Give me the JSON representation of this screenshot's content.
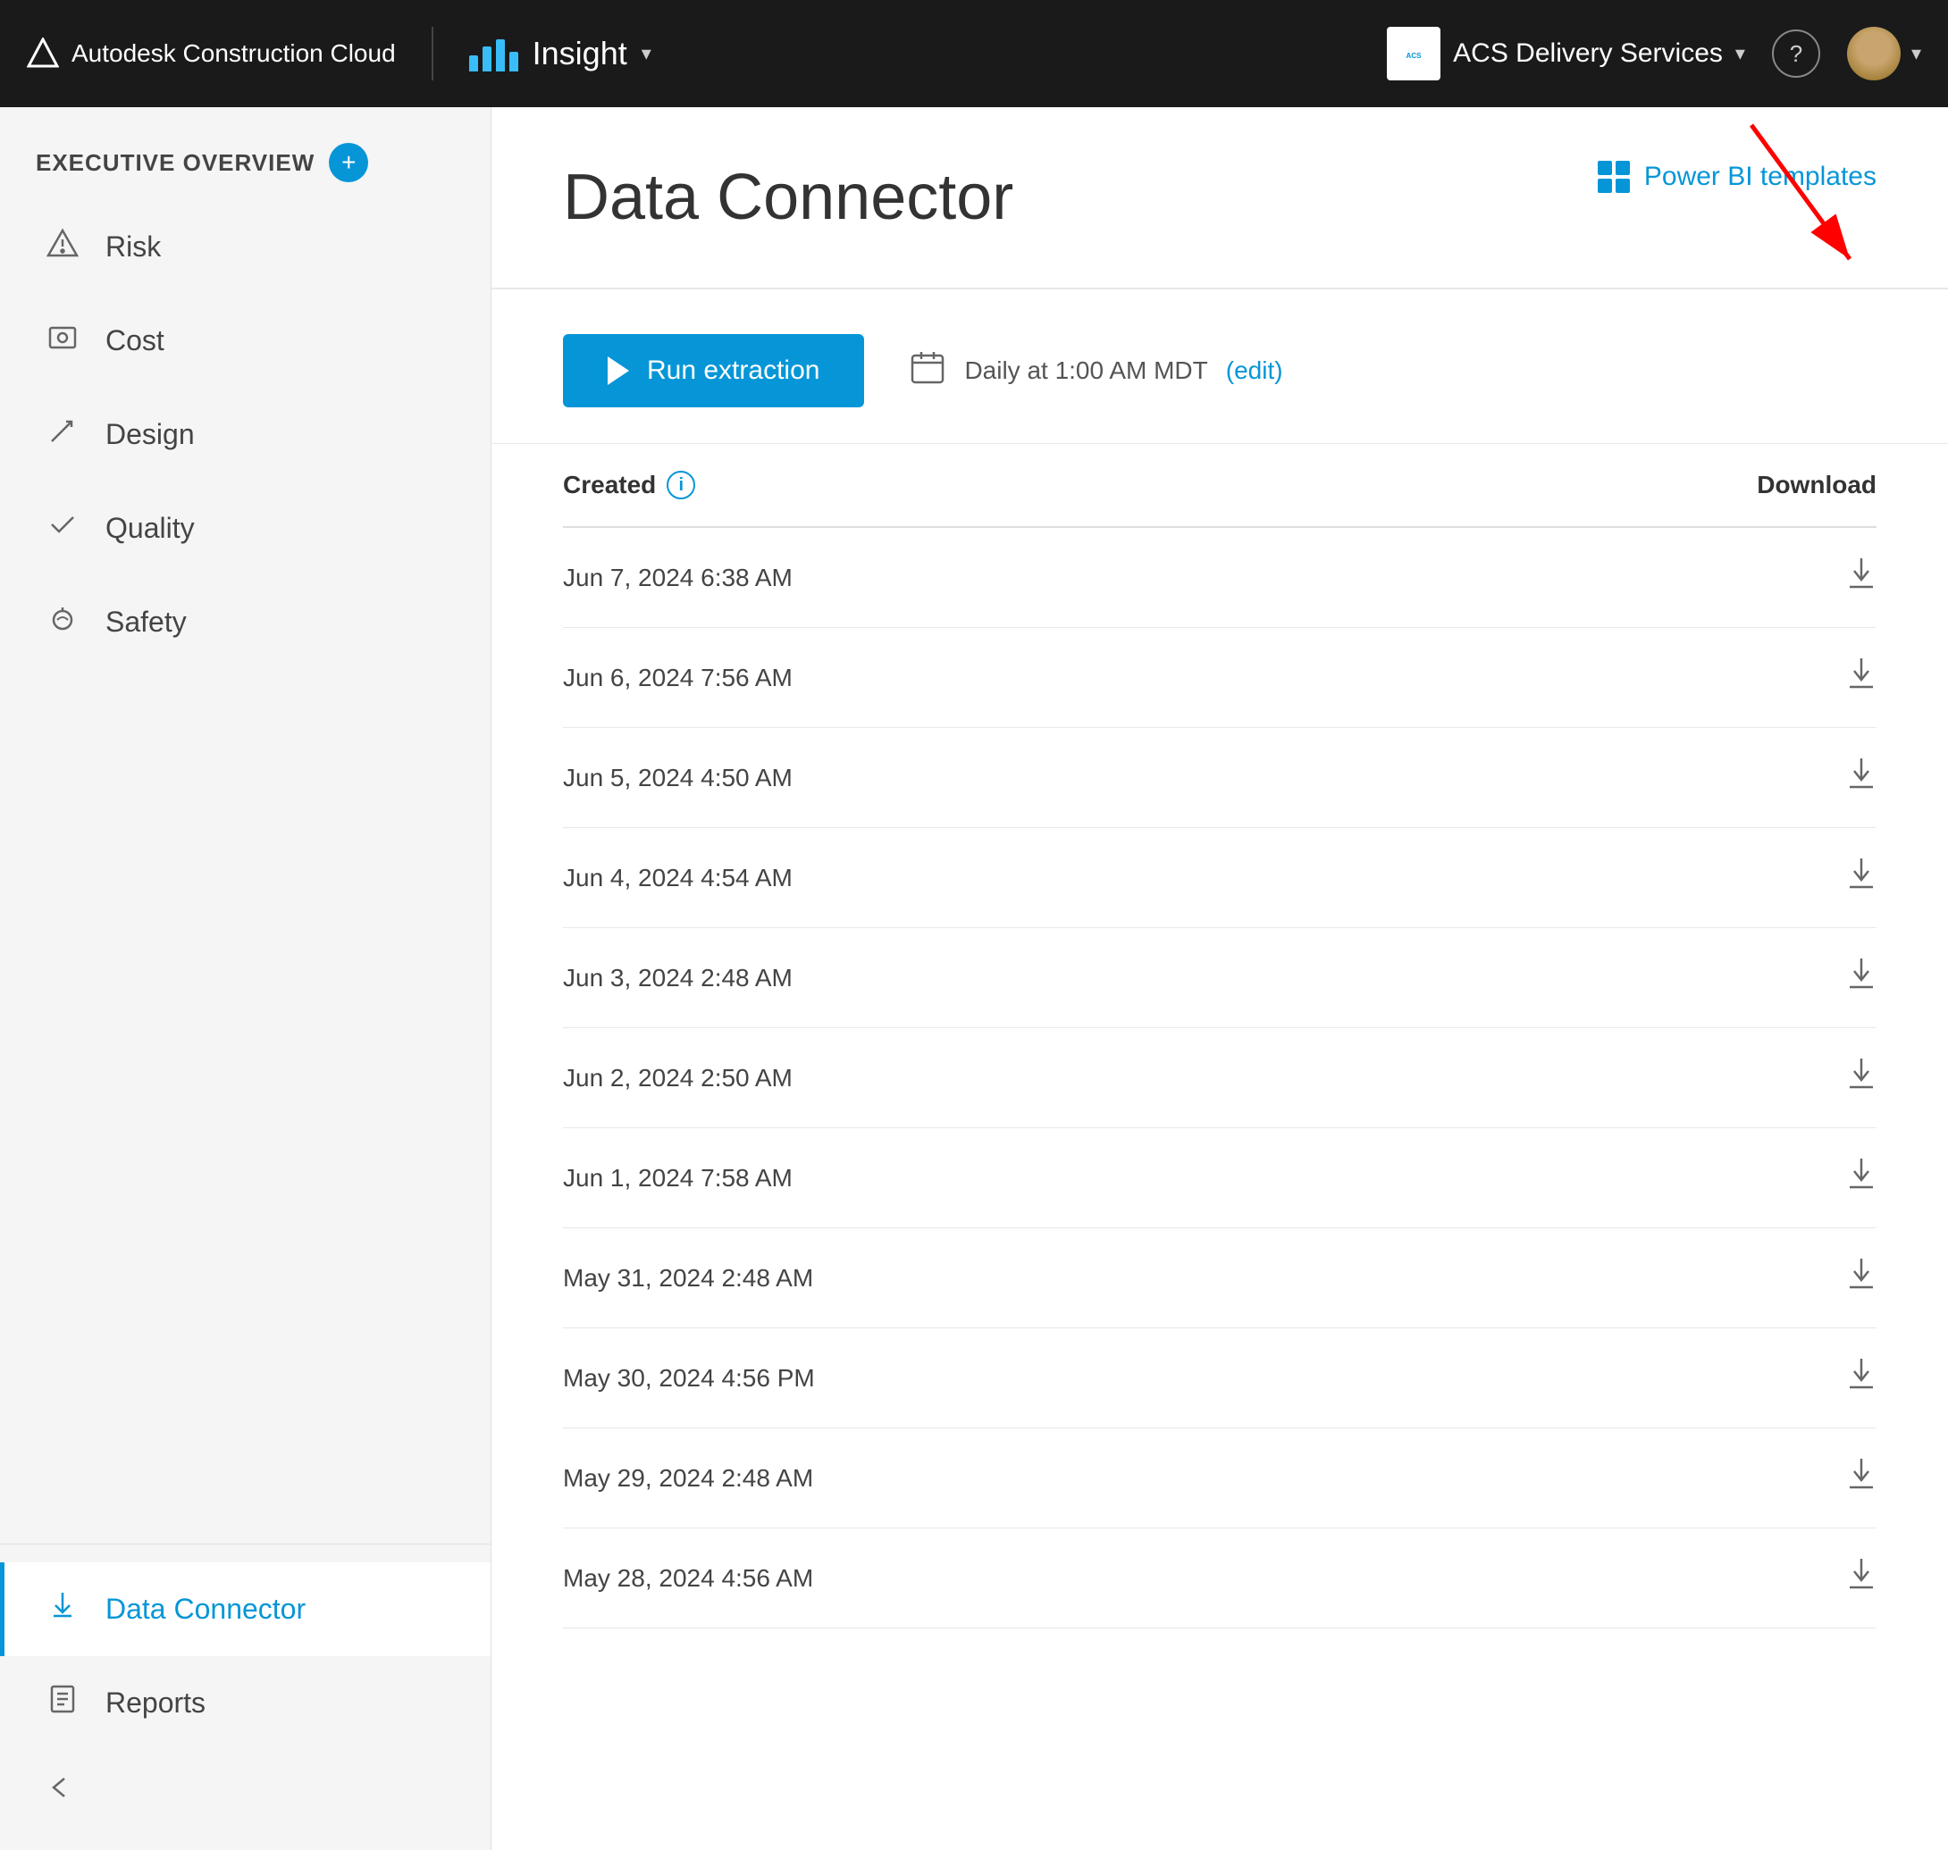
{
  "app": {
    "brand": "Autodesk Construction Cloud",
    "product": "Insight",
    "dropdown_arrow": "▾"
  },
  "org": {
    "name": "ACS Delivery Services",
    "dropdown_arrow": "▾"
  },
  "sidebar": {
    "section_label": "EXECUTIVE OVERVIEW",
    "add_label": "+",
    "nav_items": [
      {
        "id": "risk",
        "label": "Risk",
        "icon": "△"
      },
      {
        "id": "cost",
        "label": "Cost",
        "icon": "▣"
      },
      {
        "id": "design",
        "label": "Design",
        "icon": "✏"
      },
      {
        "id": "quality",
        "label": "Quality",
        "icon": "✓"
      },
      {
        "id": "safety",
        "label": "Safety",
        "icon": "⛑"
      }
    ],
    "bottom_items": [
      {
        "id": "data-connector",
        "label": "Data Connector",
        "icon": "↓",
        "active": true
      },
      {
        "id": "reports",
        "label": "Reports",
        "icon": "📋",
        "active": false
      }
    ],
    "collapse_icon": "←"
  },
  "main": {
    "page_title": "Data Connector",
    "power_bi_label": "Power BI templates",
    "run_btn_label": "Run extraction",
    "schedule_text": "Daily at 1:00 AM MDT",
    "edit_label": "(edit)",
    "table": {
      "col_created": "Created",
      "col_download": "Download",
      "rows": [
        {
          "date": "Jun 7, 2024 6:38 AM"
        },
        {
          "date": "Jun 6, 2024 7:56 AM"
        },
        {
          "date": "Jun 5, 2024 4:50 AM"
        },
        {
          "date": "Jun 4, 2024 4:54 AM"
        },
        {
          "date": "Jun 3, 2024 2:48 AM"
        },
        {
          "date": "Jun 2, 2024 2:50 AM"
        },
        {
          "date": "Jun 1, 2024 7:58 AM"
        },
        {
          "date": "May 31, 2024 2:48 AM"
        },
        {
          "date": "May 30, 2024 4:56 PM"
        },
        {
          "date": "May 29, 2024 2:48 AM"
        },
        {
          "date": "May 28, 2024 4:56 AM"
        }
      ]
    }
  }
}
